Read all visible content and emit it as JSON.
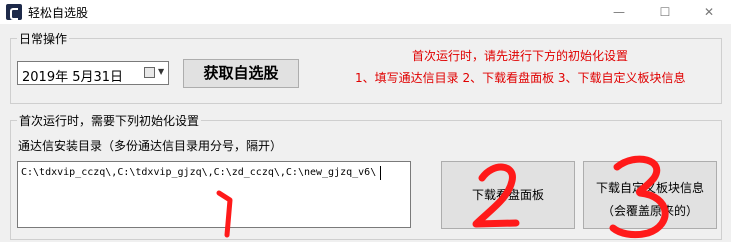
{
  "window": {
    "title": "轻松自选股",
    "minimize_label": "—",
    "maximize_label": "☐",
    "close_label": "✕"
  },
  "daily_group": {
    "legend": "日常操作",
    "date_value": "2019年  5月31日",
    "fetch_button": "获取自选股",
    "hint_line1": "首次运行时，请先进行下方的初始化设置",
    "hint_line2": "1、填写通达信目录 2、下载看盘面板 3、下载自定义板块信息"
  },
  "init_group": {
    "legend": "首次运行时，需要下列初始化设置",
    "path_label": "通达信安装目录（多份通达信目录用分号，隔开）",
    "path_value": "C:\\tdxvip_cczq\\,C:\\tdxvip_gjzq\\,C:\\zd_cczq\\,C:\\new_gjzq_v6\\",
    "download_panel_button": "下载看盘面板",
    "download_block_button_line1": "下载自定义板块信息",
    "download_block_button_line2": "（会覆盖原来的）"
  },
  "annotations": [
    "1",
    "2",
    "3"
  ],
  "colors": {
    "hint_red": "#e00000",
    "annotation_red": "#ff1a1a",
    "background": "#f0f0f0"
  }
}
